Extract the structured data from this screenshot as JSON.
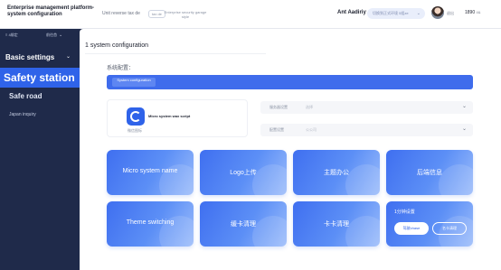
{
  "header": {
    "brand": "Enterprise management platform-system configuration",
    "nav_text": "Unit reverse tax de",
    "nav_tag": "tax de",
    "nav_desc": "Enterprise security garage style",
    "user_name": "Ant Aadiriy",
    "pill_text": "切换到正式环境 5组ze",
    "logout": "退出",
    "phone": "1890",
    "phone_suffix": "4&"
  },
  "sidebar": {
    "top_left": "≡ 4绑定",
    "top_right": "前往首",
    "section_title": "Basic settings",
    "active_item": "Safety station",
    "items": [
      "Safe road",
      "Japan inquiry"
    ]
  },
  "main": {
    "page_title": "1 system configuration",
    "system_label": "系统配置：",
    "blue_tag": "System configuration",
    "logo_text": "Micro system wax script",
    "logo_caption": "微信图标",
    "selects": [
      {
        "label": "服务器设置",
        "value": "选择"
      },
      {
        "label": "配置设置",
        "value": "公公司"
      }
    ],
    "tiles": [
      "Micro system name",
      "Logo上传",
      "主题办公",
      "后端信息",
      "Theme switching",
      "缓卡清理",
      "卡卡清理"
    ],
    "last_tile": {
      "label": "1分钟设置",
      "btn_primary": "驾驶chase",
      "btn_secondary": "名卡清理"
    }
  }
}
